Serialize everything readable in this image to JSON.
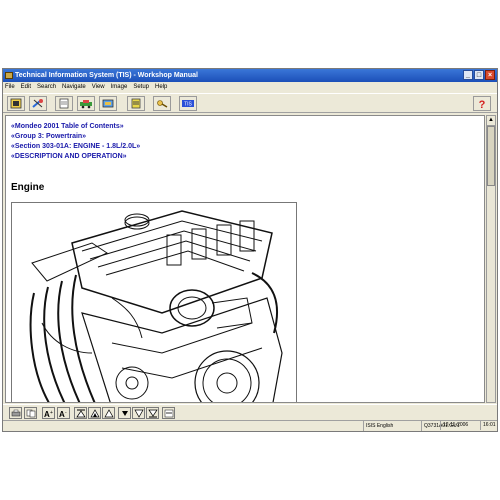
{
  "window": {
    "title": "Technical Information System (TIS) - Workshop Manual"
  },
  "menu": [
    "File",
    "Edit",
    "Search",
    "Navigate",
    "View",
    "Image",
    "Setup",
    "Help"
  ],
  "toolbar": {
    "icons": [
      "index-icon",
      "wrench-icon",
      "document-icon",
      "car-icon",
      "tools-icon",
      "notes-icon",
      "key-icon",
      "network-icon",
      "help-icon"
    ]
  },
  "content": {
    "links": [
      "«Mondeo 2001 Table of Contents»",
      "«Group 3: Powertrain»",
      "«Section 303-01A: ENGINE - 1.8L/2.0L»",
      "«DESCRIPTION AND OPERATION»"
    ],
    "heading": "Engine",
    "figure_icon": "engine-illustration"
  },
  "image_toolbar": {
    "icons": [
      "print-icon",
      "copy-icon",
      "zoom-in-icon",
      "zoom-out-icon",
      "first-icon",
      "prev-up-icon",
      "up-icon",
      "down-icon",
      "next-down-icon",
      "last-icon",
      "fit-icon"
    ]
  },
  "status": {
    "language": "ISIS English",
    "doc_id": "Q3731A01.GU1",
    "date": "12-11-2006",
    "time": "16:01"
  },
  "colors": {
    "title_bar": "#1c4fb8",
    "link": "#1a1aaa",
    "chrome": "#ece9d8"
  }
}
